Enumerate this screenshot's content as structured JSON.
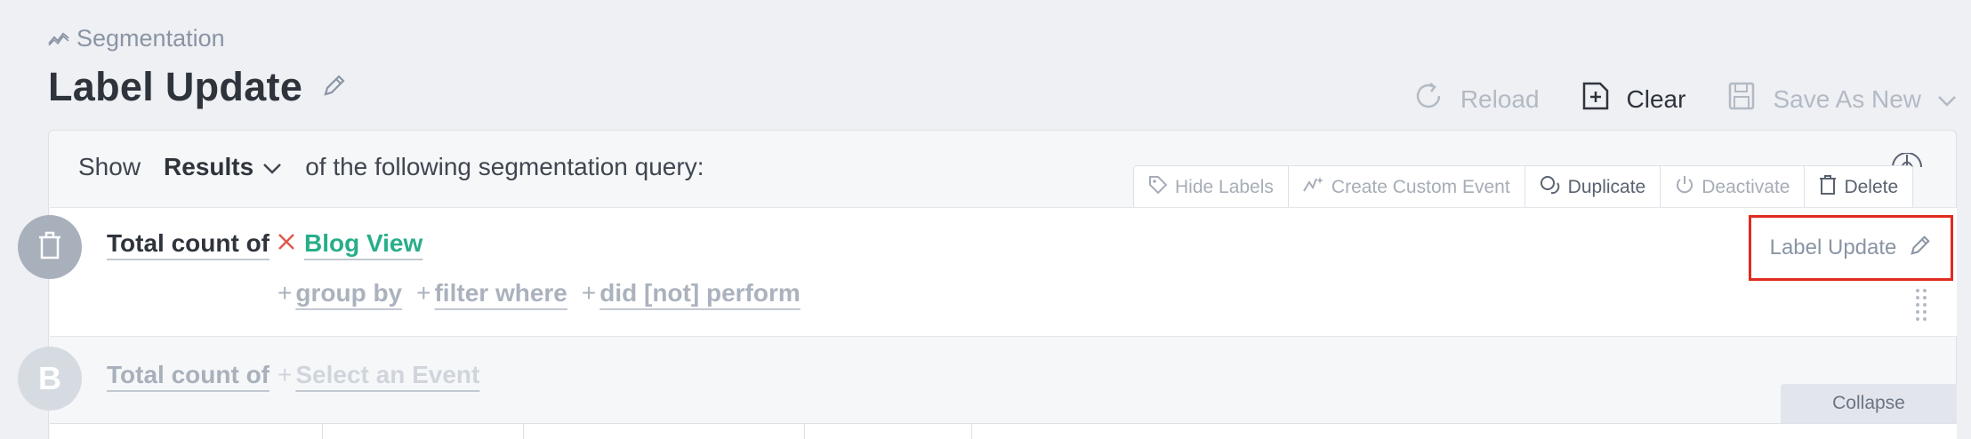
{
  "breadcrumb": {
    "label": "Segmentation",
    "icon": "segmentation-icon"
  },
  "page": {
    "title": "Label Update"
  },
  "toolbar": {
    "reload": "Reload",
    "clear": "Clear",
    "save_as_new": "Save As New"
  },
  "query": {
    "show_label": "Show",
    "results": "Results",
    "suffix": "of the following segmentation query:"
  },
  "actions": {
    "hide_labels": "Hide Labels",
    "create_custom_event": "Create Custom Event",
    "duplicate": "Duplicate",
    "deactivate": "Deactivate",
    "delete": "Delete"
  },
  "rowA": {
    "total_label": "Total count of",
    "event": "Blog View",
    "group_by": "group by",
    "filter_where": "filter where",
    "did_not_perform": "did [not] perform",
    "label": "Label Update"
  },
  "rowB": {
    "badge": "B",
    "total_label": "Total count of",
    "event_placeholder": "Select an Event"
  },
  "collapse": "Collapse",
  "colors": {
    "accent_green": "#27ae8a",
    "highlight_red": "#e02b20",
    "remove_x": "#e0584b"
  }
}
